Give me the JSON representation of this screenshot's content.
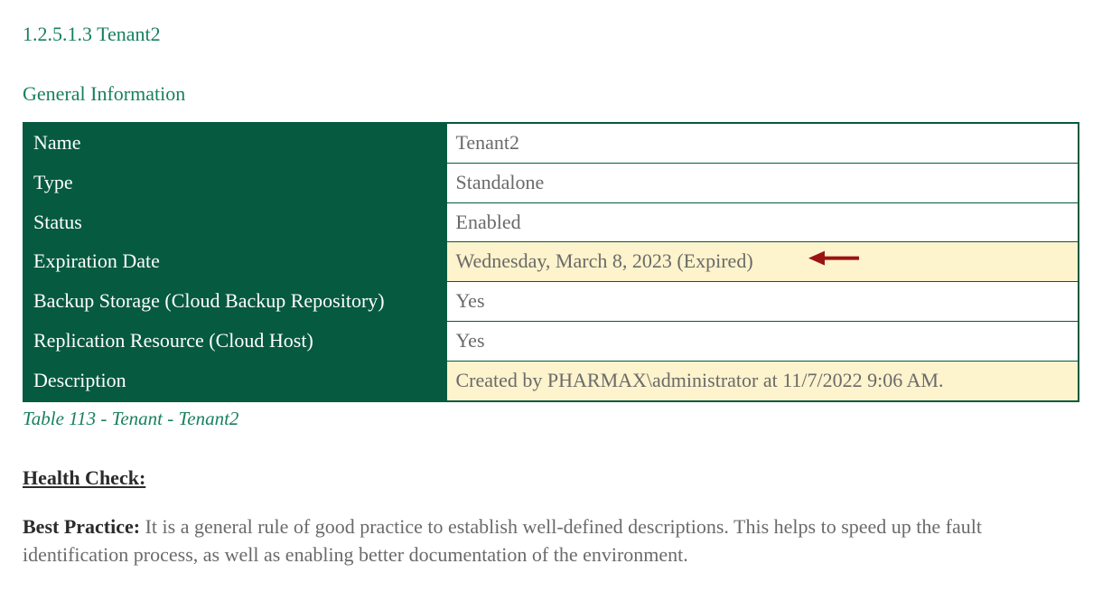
{
  "section": {
    "number": "1.2.5.1.3 Tenant2",
    "heading": "General Information"
  },
  "table": {
    "rows": [
      {
        "label": "Name",
        "value": "Tenant2",
        "highlight": false
      },
      {
        "label": "Type",
        "value": "Standalone",
        "highlight": false
      },
      {
        "label": "Status",
        "value": "Enabled",
        "highlight": false
      },
      {
        "label": "Expiration Date",
        "value": "Wednesday, March 8, 2023 (Expired)",
        "highlight": true,
        "arrow": true
      },
      {
        "label": "Backup Storage (Cloud Backup Repository)",
        "value": "Yes",
        "highlight": false
      },
      {
        "label": "Replication Resource (Cloud Host)",
        "value": "Yes",
        "highlight": false
      },
      {
        "label": "Description",
        "value": "Created by PHARMAX\\administrator at 11/7/2022 9:06 AM.",
        "highlight": true
      }
    ],
    "caption": "Table 113 - Tenant - Tenant2"
  },
  "health_check": {
    "heading": "Health Check:",
    "bp_label": "Best Practice: ",
    "bp_text": "It is a general rule of good practice to establish well-defined descriptions. This helps to speed up the fault identification process, as well as enabling better documentation of the environment."
  }
}
